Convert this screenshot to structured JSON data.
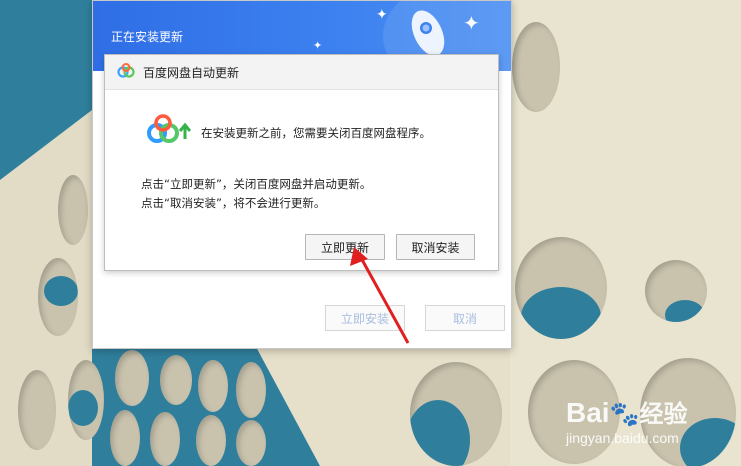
{
  "installer": {
    "title": "正在安装更新",
    "install_now_label": "立即安装",
    "cancel_label": "取消"
  },
  "dialog": {
    "title": "百度网盘自动更新",
    "message": "在安装更新之前，您需要关闭百度网盘程序。",
    "hint_update": "点击“立即更新”，关闭百度网盘并启动更新。",
    "hint_cancel": "点击“取消安装”，将不会进行更新。",
    "update_now_label": "立即更新",
    "cancel_install_label": "取消安装"
  },
  "watermark": {
    "brand": "Bai",
    "brand_suffix": "经验",
    "url": "jingyan.baidu.com"
  },
  "colors": {
    "header_blue": "#3d82f0",
    "annotation_red": "#e02020",
    "wall_blue": "#2f7f9c",
    "wall_beige": "#e9e4cf"
  },
  "icons": [
    "baidu-netdisk-icon",
    "rocket-icon",
    "sparkle-icon",
    "arrow-annotation-icon",
    "paw-icon"
  ]
}
